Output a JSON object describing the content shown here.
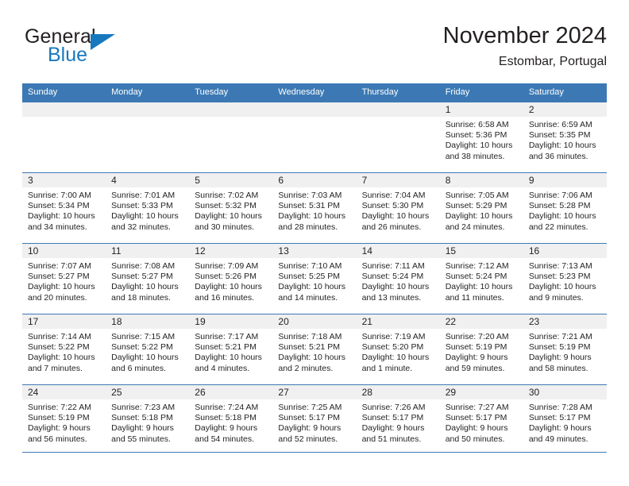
{
  "brand": {
    "name_part1": "General",
    "name_part2": "Blue",
    "triangle_color": "#1878be"
  },
  "header": {
    "title": "November 2024",
    "subtitle": "Estombar, Portugal"
  },
  "theme": {
    "header_blue": "#3c79b4",
    "daynum_band": "#f0f0f0",
    "text": "#231f20"
  },
  "weekday_headers": [
    "Sunday",
    "Monday",
    "Tuesday",
    "Wednesday",
    "Thursday",
    "Friday",
    "Saturday"
  ],
  "labels": {
    "sunrise_prefix": "Sunrise:",
    "sunset_prefix": "Sunset:",
    "daylight_prefix": "Daylight:"
  },
  "weeks": [
    [
      {
        "day": "",
        "empty": true
      },
      {
        "day": "",
        "empty": true
      },
      {
        "day": "",
        "empty": true
      },
      {
        "day": "",
        "empty": true
      },
      {
        "day": "",
        "empty": true
      },
      {
        "day": "1",
        "sunrise": "Sunrise: 6:58 AM",
        "sunset": "Sunset: 5:36 PM",
        "daylight": "Daylight: 10 hours and 38 minutes."
      },
      {
        "day": "2",
        "sunrise": "Sunrise: 6:59 AM",
        "sunset": "Sunset: 5:35 PM",
        "daylight": "Daylight: 10 hours and 36 minutes."
      }
    ],
    [
      {
        "day": "3",
        "sunrise": "Sunrise: 7:00 AM",
        "sunset": "Sunset: 5:34 PM",
        "daylight": "Daylight: 10 hours and 34 minutes."
      },
      {
        "day": "4",
        "sunrise": "Sunrise: 7:01 AM",
        "sunset": "Sunset: 5:33 PM",
        "daylight": "Daylight: 10 hours and 32 minutes."
      },
      {
        "day": "5",
        "sunrise": "Sunrise: 7:02 AM",
        "sunset": "Sunset: 5:32 PM",
        "daylight": "Daylight: 10 hours and 30 minutes."
      },
      {
        "day": "6",
        "sunrise": "Sunrise: 7:03 AM",
        "sunset": "Sunset: 5:31 PM",
        "daylight": "Daylight: 10 hours and 28 minutes."
      },
      {
        "day": "7",
        "sunrise": "Sunrise: 7:04 AM",
        "sunset": "Sunset: 5:30 PM",
        "daylight": "Daylight: 10 hours and 26 minutes."
      },
      {
        "day": "8",
        "sunrise": "Sunrise: 7:05 AM",
        "sunset": "Sunset: 5:29 PM",
        "daylight": "Daylight: 10 hours and 24 minutes."
      },
      {
        "day": "9",
        "sunrise": "Sunrise: 7:06 AM",
        "sunset": "Sunset: 5:28 PM",
        "daylight": "Daylight: 10 hours and 22 minutes."
      }
    ],
    [
      {
        "day": "10",
        "sunrise": "Sunrise: 7:07 AM",
        "sunset": "Sunset: 5:27 PM",
        "daylight": "Daylight: 10 hours and 20 minutes."
      },
      {
        "day": "11",
        "sunrise": "Sunrise: 7:08 AM",
        "sunset": "Sunset: 5:27 PM",
        "daylight": "Daylight: 10 hours and 18 minutes."
      },
      {
        "day": "12",
        "sunrise": "Sunrise: 7:09 AM",
        "sunset": "Sunset: 5:26 PM",
        "daylight": "Daylight: 10 hours and 16 minutes."
      },
      {
        "day": "13",
        "sunrise": "Sunrise: 7:10 AM",
        "sunset": "Sunset: 5:25 PM",
        "daylight": "Daylight: 10 hours and 14 minutes."
      },
      {
        "day": "14",
        "sunrise": "Sunrise: 7:11 AM",
        "sunset": "Sunset: 5:24 PM",
        "daylight": "Daylight: 10 hours and 13 minutes."
      },
      {
        "day": "15",
        "sunrise": "Sunrise: 7:12 AM",
        "sunset": "Sunset: 5:24 PM",
        "daylight": "Daylight: 10 hours and 11 minutes."
      },
      {
        "day": "16",
        "sunrise": "Sunrise: 7:13 AM",
        "sunset": "Sunset: 5:23 PM",
        "daylight": "Daylight: 10 hours and 9 minutes."
      }
    ],
    [
      {
        "day": "17",
        "sunrise": "Sunrise: 7:14 AM",
        "sunset": "Sunset: 5:22 PM",
        "daylight": "Daylight: 10 hours and 7 minutes."
      },
      {
        "day": "18",
        "sunrise": "Sunrise: 7:15 AM",
        "sunset": "Sunset: 5:22 PM",
        "daylight": "Daylight: 10 hours and 6 minutes."
      },
      {
        "day": "19",
        "sunrise": "Sunrise: 7:17 AM",
        "sunset": "Sunset: 5:21 PM",
        "daylight": "Daylight: 10 hours and 4 minutes."
      },
      {
        "day": "20",
        "sunrise": "Sunrise: 7:18 AM",
        "sunset": "Sunset: 5:21 PM",
        "daylight": "Daylight: 10 hours and 2 minutes."
      },
      {
        "day": "21",
        "sunrise": "Sunrise: 7:19 AM",
        "sunset": "Sunset: 5:20 PM",
        "daylight": "Daylight: 10 hours and 1 minute."
      },
      {
        "day": "22",
        "sunrise": "Sunrise: 7:20 AM",
        "sunset": "Sunset: 5:19 PM",
        "daylight": "Daylight: 9 hours and 59 minutes."
      },
      {
        "day": "23",
        "sunrise": "Sunrise: 7:21 AM",
        "sunset": "Sunset: 5:19 PM",
        "daylight": "Daylight: 9 hours and 58 minutes."
      }
    ],
    [
      {
        "day": "24",
        "sunrise": "Sunrise: 7:22 AM",
        "sunset": "Sunset: 5:19 PM",
        "daylight": "Daylight: 9 hours and 56 minutes."
      },
      {
        "day": "25",
        "sunrise": "Sunrise: 7:23 AM",
        "sunset": "Sunset: 5:18 PM",
        "daylight": "Daylight: 9 hours and 55 minutes."
      },
      {
        "day": "26",
        "sunrise": "Sunrise: 7:24 AM",
        "sunset": "Sunset: 5:18 PM",
        "daylight": "Daylight: 9 hours and 54 minutes."
      },
      {
        "day": "27",
        "sunrise": "Sunrise: 7:25 AM",
        "sunset": "Sunset: 5:17 PM",
        "daylight": "Daylight: 9 hours and 52 minutes."
      },
      {
        "day": "28",
        "sunrise": "Sunrise: 7:26 AM",
        "sunset": "Sunset: 5:17 PM",
        "daylight": "Daylight: 9 hours and 51 minutes."
      },
      {
        "day": "29",
        "sunrise": "Sunrise: 7:27 AM",
        "sunset": "Sunset: 5:17 PM",
        "daylight": "Daylight: 9 hours and 50 minutes."
      },
      {
        "day": "30",
        "sunrise": "Sunrise: 7:28 AM",
        "sunset": "Sunset: 5:17 PM",
        "daylight": "Daylight: 9 hours and 49 minutes."
      }
    ]
  ]
}
